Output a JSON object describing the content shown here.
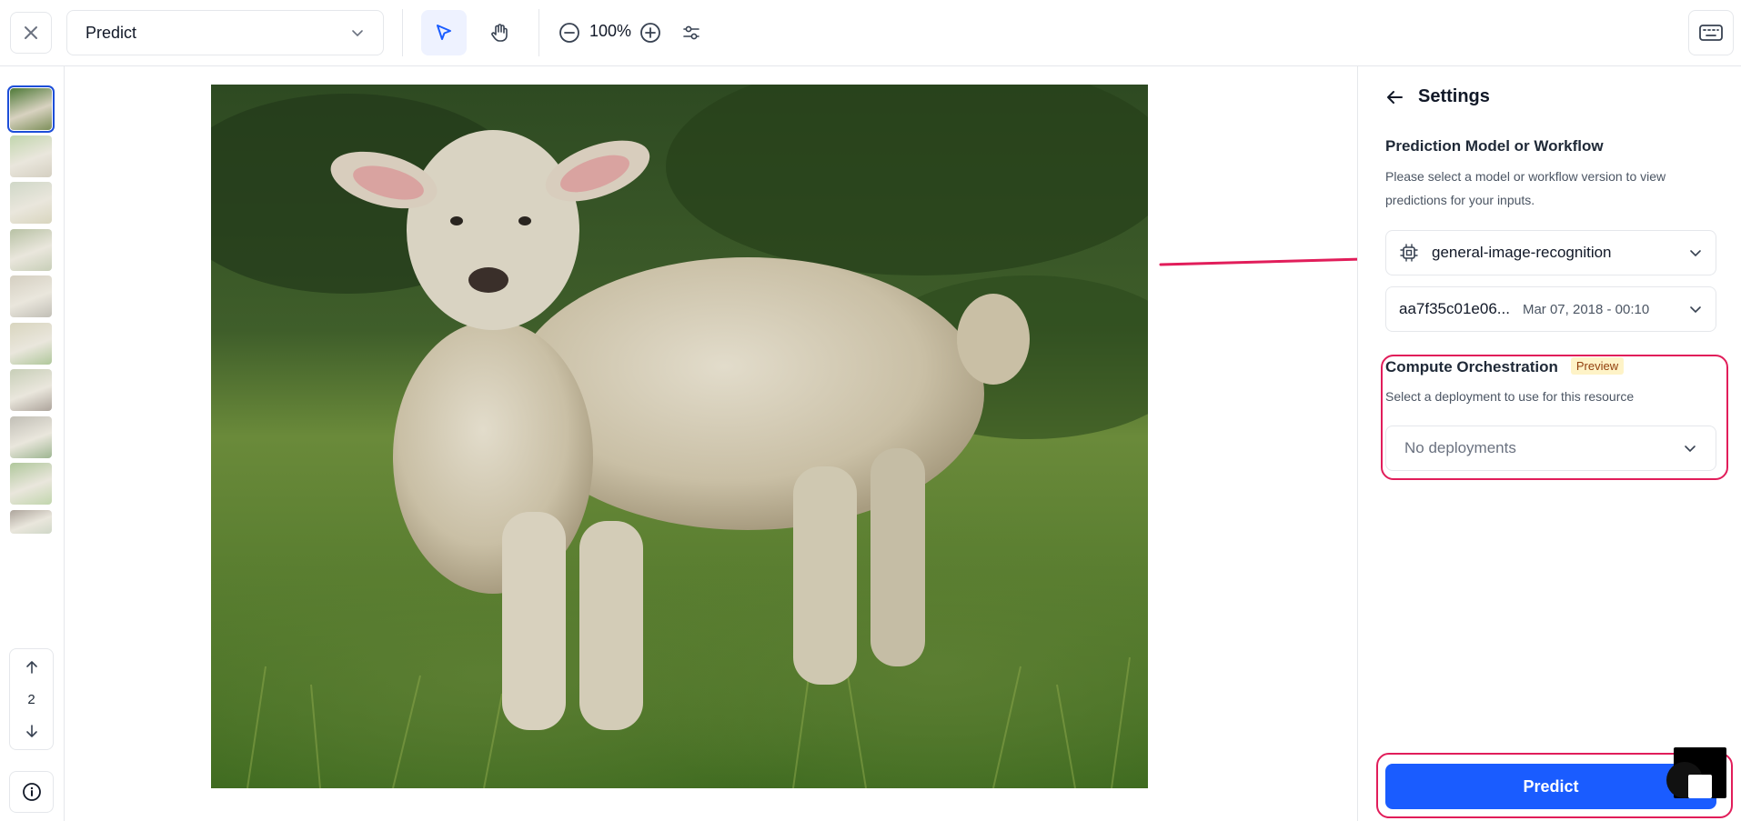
{
  "toolbar": {
    "mode_selected": "Predict",
    "zoom_level": "100%",
    "icons": [
      "close-icon",
      "chevron-down-icon",
      "pointer-icon",
      "hand-icon",
      "zoom-out-icon",
      "zoom-in-icon",
      "sliders-icon",
      "keyboard-icon"
    ]
  },
  "thumbnails": {
    "count": 10,
    "selected_index": 0,
    "page_number": "2"
  },
  "settings": {
    "title": "Settings",
    "model_section_title": "Prediction Model or Workflow",
    "model_section_desc": "Please select a model or workflow version to view predictions for your inputs.",
    "model_selected": "general-image-recognition",
    "version_id": "aa7f35c01e06...",
    "version_date": "Mar 07, 2018 - 00:10",
    "compute_title": "Compute Orchestration",
    "compute_badge": "Preview",
    "compute_desc": "Select a deployment to use for this resource",
    "deployment_placeholder": "No deployments",
    "predict_label": "Predict"
  },
  "colors": {
    "accent": "#1a5cff",
    "annotation": "#e11d5a",
    "badge_bg": "#fef3c7"
  }
}
